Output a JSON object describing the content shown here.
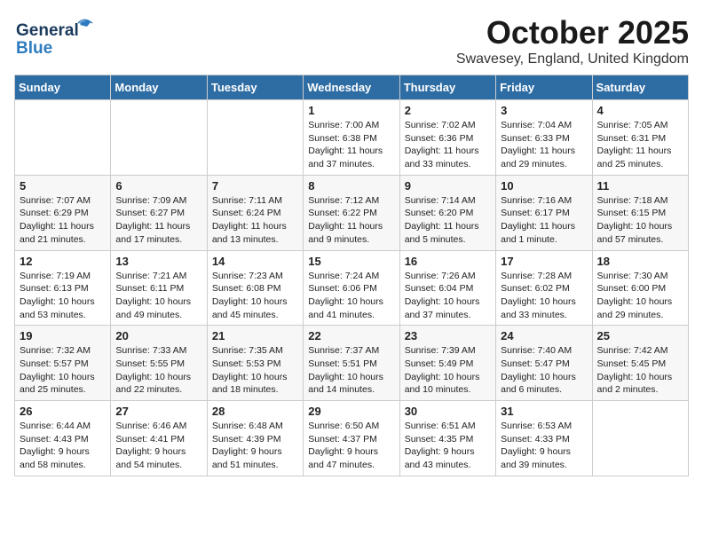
{
  "header": {
    "logo_general": "General",
    "logo_blue": "Blue",
    "month_title": "October 2025",
    "location": "Swavesey, England, United Kingdom"
  },
  "weekdays": [
    "Sunday",
    "Monday",
    "Tuesday",
    "Wednesday",
    "Thursday",
    "Friday",
    "Saturday"
  ],
  "weeks": [
    [
      {
        "day": "",
        "info": ""
      },
      {
        "day": "",
        "info": ""
      },
      {
        "day": "",
        "info": ""
      },
      {
        "day": "1",
        "info": "Sunrise: 7:00 AM\nSunset: 6:38 PM\nDaylight: 11 hours\nand 37 minutes."
      },
      {
        "day": "2",
        "info": "Sunrise: 7:02 AM\nSunset: 6:36 PM\nDaylight: 11 hours\nand 33 minutes."
      },
      {
        "day": "3",
        "info": "Sunrise: 7:04 AM\nSunset: 6:33 PM\nDaylight: 11 hours\nand 29 minutes."
      },
      {
        "day": "4",
        "info": "Sunrise: 7:05 AM\nSunset: 6:31 PM\nDaylight: 11 hours\nand 25 minutes."
      }
    ],
    [
      {
        "day": "5",
        "info": "Sunrise: 7:07 AM\nSunset: 6:29 PM\nDaylight: 11 hours\nand 21 minutes."
      },
      {
        "day": "6",
        "info": "Sunrise: 7:09 AM\nSunset: 6:27 PM\nDaylight: 11 hours\nand 17 minutes."
      },
      {
        "day": "7",
        "info": "Sunrise: 7:11 AM\nSunset: 6:24 PM\nDaylight: 11 hours\nand 13 minutes."
      },
      {
        "day": "8",
        "info": "Sunrise: 7:12 AM\nSunset: 6:22 PM\nDaylight: 11 hours\nand 9 minutes."
      },
      {
        "day": "9",
        "info": "Sunrise: 7:14 AM\nSunset: 6:20 PM\nDaylight: 11 hours\nand 5 minutes."
      },
      {
        "day": "10",
        "info": "Sunrise: 7:16 AM\nSunset: 6:17 PM\nDaylight: 11 hours\nand 1 minute."
      },
      {
        "day": "11",
        "info": "Sunrise: 7:18 AM\nSunset: 6:15 PM\nDaylight: 10 hours\nand 57 minutes."
      }
    ],
    [
      {
        "day": "12",
        "info": "Sunrise: 7:19 AM\nSunset: 6:13 PM\nDaylight: 10 hours\nand 53 minutes."
      },
      {
        "day": "13",
        "info": "Sunrise: 7:21 AM\nSunset: 6:11 PM\nDaylight: 10 hours\nand 49 minutes."
      },
      {
        "day": "14",
        "info": "Sunrise: 7:23 AM\nSunset: 6:08 PM\nDaylight: 10 hours\nand 45 minutes."
      },
      {
        "day": "15",
        "info": "Sunrise: 7:24 AM\nSunset: 6:06 PM\nDaylight: 10 hours\nand 41 minutes."
      },
      {
        "day": "16",
        "info": "Sunrise: 7:26 AM\nSunset: 6:04 PM\nDaylight: 10 hours\nand 37 minutes."
      },
      {
        "day": "17",
        "info": "Sunrise: 7:28 AM\nSunset: 6:02 PM\nDaylight: 10 hours\nand 33 minutes."
      },
      {
        "day": "18",
        "info": "Sunrise: 7:30 AM\nSunset: 6:00 PM\nDaylight: 10 hours\nand 29 minutes."
      }
    ],
    [
      {
        "day": "19",
        "info": "Sunrise: 7:32 AM\nSunset: 5:57 PM\nDaylight: 10 hours\nand 25 minutes."
      },
      {
        "day": "20",
        "info": "Sunrise: 7:33 AM\nSunset: 5:55 PM\nDaylight: 10 hours\nand 22 minutes."
      },
      {
        "day": "21",
        "info": "Sunrise: 7:35 AM\nSunset: 5:53 PM\nDaylight: 10 hours\nand 18 minutes."
      },
      {
        "day": "22",
        "info": "Sunrise: 7:37 AM\nSunset: 5:51 PM\nDaylight: 10 hours\nand 14 minutes."
      },
      {
        "day": "23",
        "info": "Sunrise: 7:39 AM\nSunset: 5:49 PM\nDaylight: 10 hours\nand 10 minutes."
      },
      {
        "day": "24",
        "info": "Sunrise: 7:40 AM\nSunset: 5:47 PM\nDaylight: 10 hours\nand 6 minutes."
      },
      {
        "day": "25",
        "info": "Sunrise: 7:42 AM\nSunset: 5:45 PM\nDaylight: 10 hours\nand 2 minutes."
      }
    ],
    [
      {
        "day": "26",
        "info": "Sunrise: 6:44 AM\nSunset: 4:43 PM\nDaylight: 9 hours\nand 58 minutes."
      },
      {
        "day": "27",
        "info": "Sunrise: 6:46 AM\nSunset: 4:41 PM\nDaylight: 9 hours\nand 54 minutes."
      },
      {
        "day": "28",
        "info": "Sunrise: 6:48 AM\nSunset: 4:39 PM\nDaylight: 9 hours\nand 51 minutes."
      },
      {
        "day": "29",
        "info": "Sunrise: 6:50 AM\nSunset: 4:37 PM\nDaylight: 9 hours\nand 47 minutes."
      },
      {
        "day": "30",
        "info": "Sunrise: 6:51 AM\nSunset: 4:35 PM\nDaylight: 9 hours\nand 43 minutes."
      },
      {
        "day": "31",
        "info": "Sunrise: 6:53 AM\nSunset: 4:33 PM\nDaylight: 9 hours\nand 39 minutes."
      },
      {
        "day": "",
        "info": ""
      }
    ]
  ]
}
